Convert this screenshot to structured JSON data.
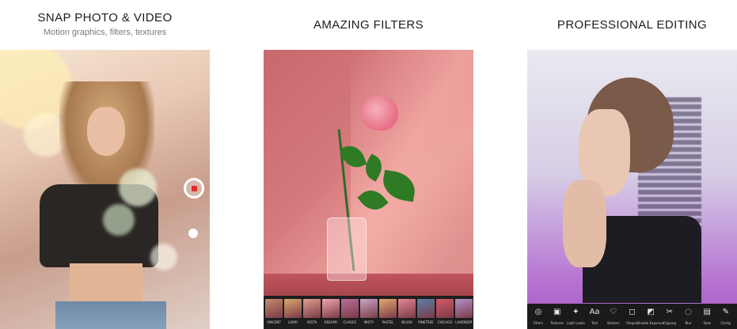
{
  "panels": [
    {
      "title": "SNAP PHOTO & VIDEO",
      "subtitle": "Motion graphics, filters, textures"
    },
    {
      "title": "AMAZING FILTERS",
      "filters": [
        {
          "label": "VINCENT",
          "color": "#c58b6c"
        },
        {
          "label": "LOMO",
          "color": "#d8a86a"
        },
        {
          "label": "VESTA",
          "color": "#e09f8f"
        },
        {
          "label": "DREAMY",
          "color": "#f0a4b0"
        },
        {
          "label": "CLASSIC",
          "color": "#b86f9a"
        },
        {
          "label": "MISTY",
          "color": "#c9a6c5"
        },
        {
          "label": "PASTEL",
          "color": "#e3a96f"
        },
        {
          "label": "BLUSH",
          "color": "#e48694"
        },
        {
          "label": "PINETREE",
          "color": "#5b7fa8"
        },
        {
          "label": "CHICAGO",
          "color": "#d25b68"
        },
        {
          "label": "LAVENDER",
          "color": "#b491c9"
        }
      ]
    },
    {
      "title": "PROFESSIONAL EDITING",
      "tools": [
        {
          "icon": "◎",
          "icon_name": "filters-icon",
          "label": "Filters"
        },
        {
          "icon": "▣",
          "icon_name": "textures-icon",
          "label": "Textures"
        },
        {
          "icon": "✦",
          "icon_name": "light-leaks-icon",
          "label": "Light Leaks"
        },
        {
          "icon": "Aa",
          "icon_name": "text-icon",
          "label": "Text"
        },
        {
          "icon": "♡",
          "icon_name": "stickers-icon",
          "label": "Stickers"
        },
        {
          "icon": "◻",
          "icon_name": "shapes-icon",
          "label": "Shapes"
        },
        {
          "icon": "◩",
          "icon_name": "double-exposure-icon",
          "label": "Double Exposure"
        },
        {
          "icon": "✂",
          "icon_name": "clipping-icon",
          "label": "Clipping"
        },
        {
          "icon": "◌",
          "icon_name": "blur-icon",
          "label": "Blur"
        },
        {
          "icon": "▤",
          "icon_name": "slow-icon",
          "label": "Slow"
        },
        {
          "icon": "✎",
          "icon_name": "clarity-icon",
          "label": "Clarity"
        }
      ]
    }
  ],
  "colors": {
    "record": "#e12c2c",
    "toolbar_bg": "#1a1a1a"
  }
}
